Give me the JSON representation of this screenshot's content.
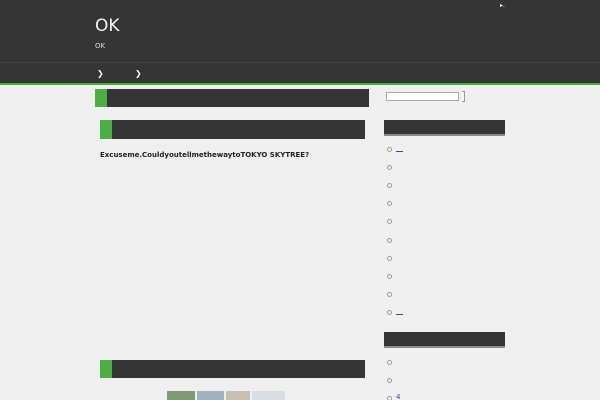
{
  "header": {
    "site_title": "OK",
    "site_description": "OK",
    "rss_label": "▸."
  },
  "nav": {
    "items": [
      {
        "label": "❯"
      },
      {
        "label": "❯"
      }
    ]
  },
  "main": {
    "post_title": "Excuseme.CouldyoutellmethewaytoTOKYO SKYTREE?"
  },
  "sidebar": {
    "search": {
      "value": "",
      "placeholder": ""
    },
    "widget1": {
      "title": "",
      "items": [
        {
          "label": "__"
        },
        {
          "label": ""
        },
        {
          "label": ""
        },
        {
          "label": ""
        },
        {
          "label": ""
        },
        {
          "label": ""
        },
        {
          "label": ""
        },
        {
          "label": ""
        },
        {
          "label": ""
        },
        {
          "label": "__"
        }
      ]
    },
    "widget2": {
      "title": "",
      "items": [
        {
          "label": ""
        },
        {
          "label": ""
        },
        {
          "label": "4"
        }
      ]
    }
  },
  "colors": {
    "bar_dark": "#353535",
    "accent_green": "#4caf45",
    "page_background": "#efefef",
    "link_blue": "#2b4fa6"
  }
}
